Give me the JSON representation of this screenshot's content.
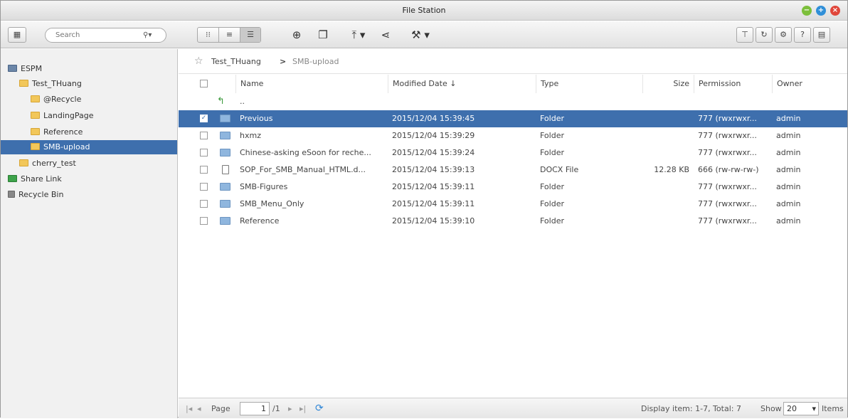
{
  "window": {
    "title": "File Station"
  },
  "toolbar": {
    "search_placeholder": "Search",
    "search_icon": "magnifier-dropdown-icon",
    "icons": [
      "sidebar-toggle-icon",
      "thumbnail-view-icon",
      "list-view-icon",
      "detail-view-icon",
      "create-folder-icon",
      "copy-icon",
      "upload-icon",
      "share-icon",
      "tools-icon",
      "filter-icon",
      "refresh-icon",
      "settings-icon",
      "help-icon",
      "more-icon"
    ]
  },
  "sidebar": {
    "root": "ESPM",
    "items": [
      {
        "label": "Test_THuang"
      },
      {
        "label": "@Recycle"
      },
      {
        "label": "LandingPage"
      },
      {
        "label": "Reference"
      },
      {
        "label": "SMB-upload"
      },
      {
        "label": "cherry_test"
      }
    ],
    "share_link": "Share Link",
    "recycle_bin": "Recycle Bin"
  },
  "breadcrumb": {
    "parent": "Test_THuang",
    "separator": ">",
    "current": "SMB-upload"
  },
  "table": {
    "headers": {
      "name": "Name",
      "modified": "Modified Date ↓",
      "type": "Type",
      "size": "Size",
      "permission": "Permission",
      "owner": "Owner"
    },
    "parent_row": "..",
    "rows": [
      {
        "name": "Previous",
        "modified": "2015/12/04 15:39:45",
        "type": "Folder",
        "size": "",
        "permission": "777 (rwxrwxr...",
        "owner": "admin"
      },
      {
        "name": "hxmz",
        "modified": "2015/12/04 15:39:29",
        "type": "Folder",
        "size": "",
        "permission": "777 (rwxrwxr...",
        "owner": "admin"
      },
      {
        "name": "Chinese-asking eSoon for reche...",
        "modified": "2015/12/04 15:39:24",
        "type": "Folder",
        "size": "",
        "permission": "777 (rwxrwxr...",
        "owner": "admin"
      },
      {
        "name": "SOP_For_SMB_Manual_HTML.d...",
        "modified": "2015/12/04 15:39:13",
        "type": "DOCX File",
        "size": "12.28 KB",
        "permission": "666 (rw-rw-rw-)",
        "owner": "admin"
      },
      {
        "name": "SMB-Figures",
        "modified": "2015/12/04 15:39:11",
        "type": "Folder",
        "size": "",
        "permission": "777 (rwxrwxr...",
        "owner": "admin"
      },
      {
        "name": "SMB_Menu_Only",
        "modified": "2015/12/04 15:39:11",
        "type": "Folder",
        "size": "",
        "permission": "777 (rwxrwxr...",
        "owner": "admin"
      },
      {
        "name": "Reference",
        "modified": "2015/12/04 15:39:10",
        "type": "Folder",
        "size": "",
        "permission": "777 (rwxrwxr...",
        "owner": "admin"
      }
    ]
  },
  "footer": {
    "page_label": "Page",
    "page_value": "1",
    "page_total": "/1",
    "display_info": "Display item: 1-7, Total: 7",
    "show_label": "Show",
    "show_value": "20",
    "items_label": "Items"
  },
  "colors": {
    "selection": "#3e6fad",
    "folder": "#f2c75a",
    "file_folder": "#8fb6de"
  }
}
